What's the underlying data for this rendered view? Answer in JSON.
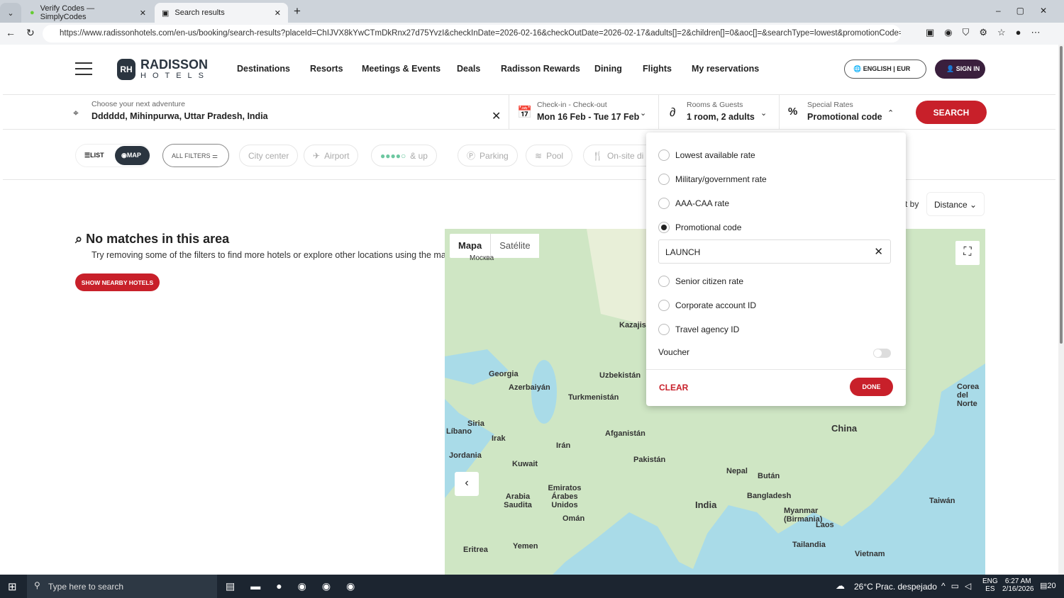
{
  "browser": {
    "tabs": [
      {
        "title": "Verify Codes — SimplyCodes",
        "active": false
      },
      {
        "title": "Search results",
        "active": true
      }
    ],
    "url": "https://www.radissonhotels.com/en-us/booking/search-results?placeId=ChIJVX8kYwCTmDkRnx27d75YvzI&checkInDate=2026-02-16&checkOutDate=2026-02-17&adults[]=2&children[]=0&aoc[]=&searchType=lowest&promotionCode=&v..."
  },
  "header": {
    "logo_top": "RADISSON",
    "logo_bottom": "HOTELS",
    "nav": [
      "Destinations",
      "Resorts",
      "Meetings & Events",
      "Deals",
      "Radisson Rewards",
      "Dining",
      "Flights",
      "My reservations"
    ],
    "language": "ENGLISH",
    "currency": "EUR",
    "sign_in": "SIGN IN"
  },
  "search": {
    "destination_label": "Choose your next adventure",
    "destination_value": "Dddddd, Mihinpurwa, Uttar Pradesh, India",
    "dates_label": "Check-in - Check-out",
    "dates_value": "Mon 16 Feb - Tue 17 Feb",
    "rooms_label": "Rooms & Guests",
    "rooms_value": "1 room, 2 adults",
    "rates_label": "Special Rates",
    "rates_value": "Promotional code",
    "search_button": "SEARCH"
  },
  "filters": {
    "list": "LIST",
    "map": "MAP",
    "all_filters": "ALL FILTERS",
    "chips": [
      "City center",
      "Airport",
      "& up",
      "Parking",
      "Pool",
      "On-site di"
    ]
  },
  "results": {
    "title": "No matches in this area",
    "subtitle": "Try removing some of the filters to find more hotels or explore other locations using the map",
    "nearby_button": "SHOW NEARBY HOTELS",
    "sort_label": "t by",
    "sort_value": "Distance"
  },
  "rates_dropdown": {
    "options": [
      {
        "label": "Lowest available rate",
        "selected": false
      },
      {
        "label": "Military/government rate",
        "selected": false
      },
      {
        "label": "AAA-CAA rate",
        "selected": false
      },
      {
        "label": "Promotional code",
        "selected": true
      },
      {
        "label": "Senior citizen rate",
        "selected": false
      },
      {
        "label": "Corporate account ID",
        "selected": false
      },
      {
        "label": "Travel agency ID",
        "selected": false
      }
    ],
    "promo_code": "LAUNCH",
    "voucher_label": "Voucher",
    "voucher_on": false,
    "clear": "CLEAR",
    "done": "DONE"
  },
  "map": {
    "tab_map": "Mapa",
    "tab_satellite": "Satélite",
    "labels": [
      "Москва",
      "Kazajistán",
      "Georgia",
      "Azerbaiyán",
      "Uzbekistán",
      "Turkmenistán",
      "Siria",
      "Líbano",
      "Irak",
      "Irán",
      "Afganistán",
      "Pakistán",
      "Kuwait",
      "Jordania",
      "Arabia Saudita",
      "Emiratos Árabes Unidos",
      "Omán",
      "Yemen",
      "Eritrea",
      "Nepal",
      "Bután",
      "Bangladesh",
      "India",
      "Myanmar (Birmania)",
      "Laos",
      "Tailandia",
      "Vietnam",
      "China",
      "Taiwán",
      "Corea del Norte"
    ]
  },
  "taskbar": {
    "search_placeholder": "Type here to search",
    "weather": "26°C  Prac. despejado",
    "lang1": "ENG",
    "lang2": "ES",
    "time": "6:27 AM",
    "date": "2/16/2026",
    "notifications": "20"
  }
}
